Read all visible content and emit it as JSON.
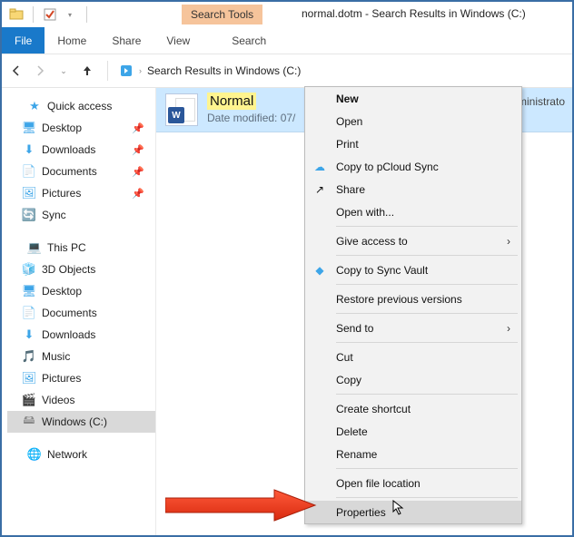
{
  "window_title": "normal.dotm - Search Results in Windows (C:)",
  "search_tools_tab": "Search Tools",
  "ribbon": {
    "file": "File",
    "home": "Home",
    "share": "Share",
    "view": "View",
    "search": "Search"
  },
  "address_bar": "Search Results in Windows (C:)",
  "tree": {
    "quick_access": "Quick access",
    "desktop": "Desktop",
    "downloads": "Downloads",
    "documents": "Documents",
    "pictures": "Pictures",
    "sync": "Sync",
    "this_pc": "This PC",
    "objects3d": "3D Objects",
    "desktop2": "Desktop",
    "documents2": "Documents",
    "downloads2": "Downloads",
    "music": "Music",
    "pictures2": "Pictures",
    "videos": "Videos",
    "windows_c": "Windows (C:)",
    "network": "Network"
  },
  "result": {
    "name": "Normal",
    "date_label": "Date modified: 07/",
    "path": "C:\\Users\\Administrato"
  },
  "context_menu": {
    "new": "New",
    "open": "Open",
    "print": "Print",
    "copy_pcloud": "Copy to pCloud Sync",
    "share": "Share",
    "open_with": "Open with...",
    "give_access": "Give access to",
    "copy_sync_vault": "Copy to Sync Vault",
    "restore_previous": "Restore previous versions",
    "send_to": "Send to",
    "cut": "Cut",
    "copy": "Copy",
    "create_shortcut": "Create shortcut",
    "delete": "Delete",
    "rename": "Rename",
    "open_file_location": "Open file location",
    "properties": "Properties"
  }
}
